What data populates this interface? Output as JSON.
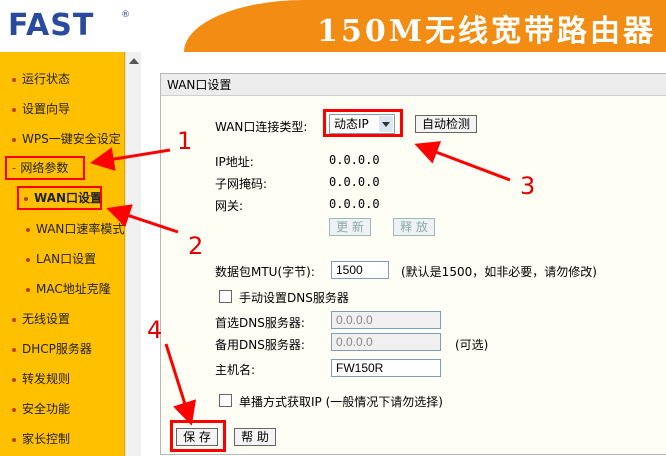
{
  "header": {
    "logo": "FAST",
    "title": "150M无线宽带路由器"
  },
  "sidebar": {
    "items": [
      {
        "label": "运行状态"
      },
      {
        "label": "设置向导"
      },
      {
        "label": "WPS一键安全设定"
      },
      {
        "label": "网络参数"
      },
      {
        "label": "WAN口设置"
      },
      {
        "label": "WAN口速率模式"
      },
      {
        "label": "LAN口设置"
      },
      {
        "label": "MAC地址克隆"
      },
      {
        "label": "无线设置"
      },
      {
        "label": "DHCP服务器"
      },
      {
        "label": "转发规则"
      },
      {
        "label": "安全功能"
      },
      {
        "label": "家长控制"
      }
    ]
  },
  "panel": {
    "title": "WAN口设置",
    "conn_type_label": "WAN口连接类型:",
    "conn_type_value": "动态IP",
    "auto_detect": "自动检测",
    "ip_label": "IP地址:",
    "ip_value": "0.0.0.0",
    "mask_label": "子网掩码:",
    "mask_value": "0.0.0.0",
    "gateway_label": "网关:",
    "gateway_value": "0.0.0.0",
    "renew": "更 新",
    "release": "释 放",
    "mtu_label": "数据包MTU(字节):",
    "mtu_value": "1500",
    "mtu_hint": "(默认是1500，如非必要，请勿修改)",
    "manual_dns_label": "手动设置DNS服务器",
    "dns1_label": "首选DNS服务器:",
    "dns1_value": "0.0.0.0",
    "dns2_label": "备用DNS服务器:",
    "dns2_value": "0.0.0.0",
    "dns2_hint": "(可选)",
    "hostname_label": "主机名:",
    "hostname_value": "FW150R",
    "unicast_label": "单播方式获取IP  (一般情况下请勿选择)",
    "save": "保 存",
    "help": "帮 助"
  },
  "annotations": [
    "1",
    "2",
    "3",
    "4"
  ],
  "colors": {
    "sidebar": "#ffc000",
    "banner": "#f28c12",
    "logo": "#2a4a9e",
    "annotation": "#ff0000"
  }
}
